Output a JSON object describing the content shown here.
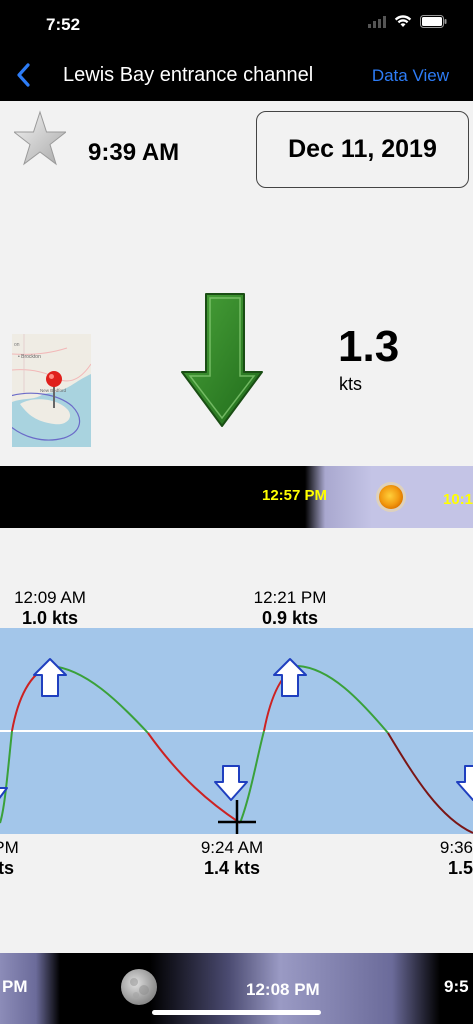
{
  "status": {
    "time": "7:52"
  },
  "nav": {
    "title": "Lewis Bay entrance channel",
    "action": "Data View"
  },
  "header": {
    "time": "9:39 AM",
    "date": "Dec 11, 2019"
  },
  "current": {
    "speed": "1.3",
    "unit": "kts",
    "direction": "down"
  },
  "sun_strip": {
    "sunset_time": "12:57 PM",
    "right_partial": "10:1"
  },
  "tides": {
    "top": [
      {
        "time": "12:09 AM",
        "value": "1.0 kts"
      },
      {
        "time": "12:21 PM",
        "value": "0.9 kts"
      }
    ],
    "bottom": [
      {
        "time": "PM",
        "value": "ts"
      },
      {
        "time": "9:24 AM",
        "value": "1.4 kts"
      },
      {
        "time": "9:36",
        "value": "1.5"
      }
    ]
  },
  "moon_strip": {
    "left_partial": "PM",
    "moonrise": "12:08 PM",
    "right_partial": "9:5"
  },
  "colors": {
    "accent": "#2d7cf6",
    "graph_bg": "#a3c6ea",
    "flood": "#4caf50",
    "ebb": "#d32f2f",
    "sun_label": "#ffff00"
  },
  "icons": [
    "back-chevron-icon",
    "star-icon",
    "map-pin-icon",
    "current-arrow-icon",
    "sun-icon",
    "moon-icon",
    "wifi-icon",
    "battery-icon"
  ]
}
